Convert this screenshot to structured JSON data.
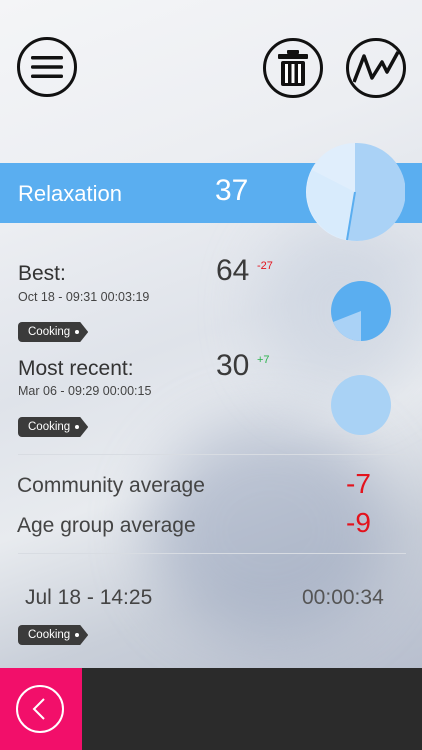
{
  "header": {
    "activity": "Relaxation",
    "score": "37"
  },
  "best": {
    "label": "Best:",
    "datetime": "Oct 18 - 09:31  00:03:19",
    "score": "64",
    "delta": "-27",
    "tag": "Cooking"
  },
  "recent": {
    "label": "Most recent:",
    "datetime": "Mar 06 - 09:29  00:00:15",
    "score": "30",
    "delta": "+7",
    "tag": "Cooking"
  },
  "averages": [
    {
      "label": "Community average",
      "value": "-7"
    },
    {
      "label": "Age group average",
      "value": "-9"
    }
  ],
  "session": {
    "datetime": "Jul 18 - 14:25",
    "duration": "00:00:34",
    "tag": "Cooking"
  },
  "icons": {
    "menu": "menu-icon",
    "trash": "trash-icon",
    "graph": "graph-icon",
    "back": "back-arrow-icon"
  },
  "colors": {
    "accent": "#5aaef0",
    "negative": "#e3131d",
    "positive": "#2bb24c",
    "footer_pink": "#f20f6a",
    "footer_dark": "#2b2b2b"
  }
}
